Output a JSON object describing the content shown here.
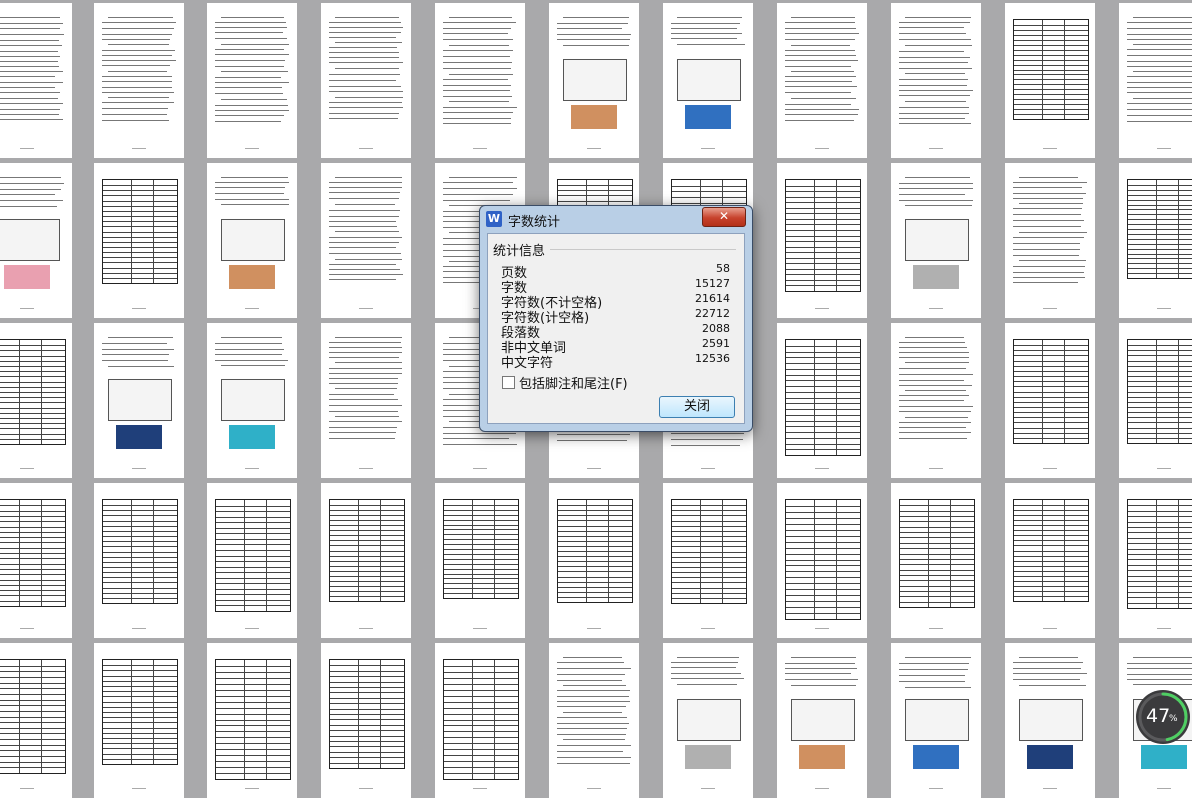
{
  "dialog": {
    "title": "字数统计",
    "app_icon_letter": "W",
    "close_icon": "close-icon",
    "group_label": "统计信息",
    "stats": [
      {
        "label": "页数",
        "value": "58"
      },
      {
        "label": "字数",
        "value": "15127"
      },
      {
        "label": "字符数(不计空格)",
        "value": "21614"
      },
      {
        "label": "字符数(计空格)",
        "value": "22712"
      },
      {
        "label": "段落数",
        "value": "2088"
      },
      {
        "label": "非中文单词",
        "value": "2591"
      },
      {
        "label": "中文字符",
        "value": "12536"
      }
    ],
    "include_footnotes_label": "包括脚注和尾注(F)",
    "include_footnotes_checked": false,
    "close_button_label": "关闭"
  },
  "zoom": {
    "value": "47",
    "unit": "%",
    "fraction": 0.47
  },
  "colors": {
    "accent": "#2f62c6",
    "close": "#c7422c",
    "ring": "#4fcf63"
  }
}
